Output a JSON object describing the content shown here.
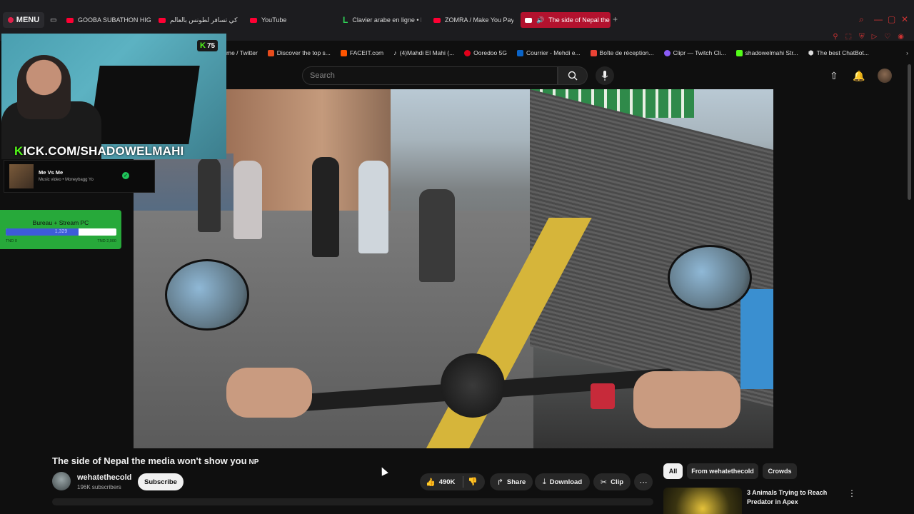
{
  "browser": {
    "menu_label": "MENU",
    "tabs": [
      {
        "label": "GOOBA SUBATHON HIGH"
      },
      {
        "label": "كي تسافر لطونس بالعالم"
      },
      {
        "label": "YouTube"
      },
      {
        "label": "Clavier arabe en ligne • L"
      },
      {
        "label": "ZOMRA / Make You Pay |"
      },
      {
        "label": "The side of Nepal the"
      }
    ],
    "bookmarks": [
      {
        "label": "me / Twitter"
      },
      {
        "label": "Discover the top s..."
      },
      {
        "label": "FACEIT.com"
      },
      {
        "label": "(4)Mahdi El Mahi (..."
      },
      {
        "label": "Ooredoo 5G"
      },
      {
        "label": "Courrier - Mehdi e..."
      },
      {
        "label": "Boîte de réception..."
      },
      {
        "label": "Clipr — Twitch Cli..."
      },
      {
        "label": "shadowelmahi Str..."
      },
      {
        "label": "The best ChatBot..."
      }
    ]
  },
  "youtube": {
    "search_placeholder": "Search",
    "video": {
      "title": "The side of Nepal the media won't show you",
      "title_flag": "NP",
      "channel": "wehatethecold",
      "subscribers": "196K subscribers",
      "subscribe_label": "Subscribe",
      "likes": "490K",
      "share_label": "Share",
      "download_label": "Download",
      "clip_label": "Clip"
    },
    "chips": [
      "All",
      "From wehatethecold",
      "Crowds"
    ],
    "recommendation": {
      "title": "3 Animals Trying to Reach Predator in Apex"
    }
  },
  "overlay": {
    "kick_viewers": "75",
    "kick_url_k": "K",
    "kick_url_rest": "ICK.COM/SHADOWELMAHI",
    "now_playing": {
      "title": "Me Vs Me",
      "subtitle": "Music video • Moneybagg Yo"
    },
    "goal": {
      "title": "Bureau + Stream PC",
      "current": "1,329",
      "min": "TND 0",
      "max": "TND 2,000",
      "progress": 0.66
    }
  },
  "colors": {
    "accent": "#ff0033",
    "kick_green": "#53fc18",
    "goal_green": "#27a93a",
    "active_tab": "#b3122e"
  }
}
